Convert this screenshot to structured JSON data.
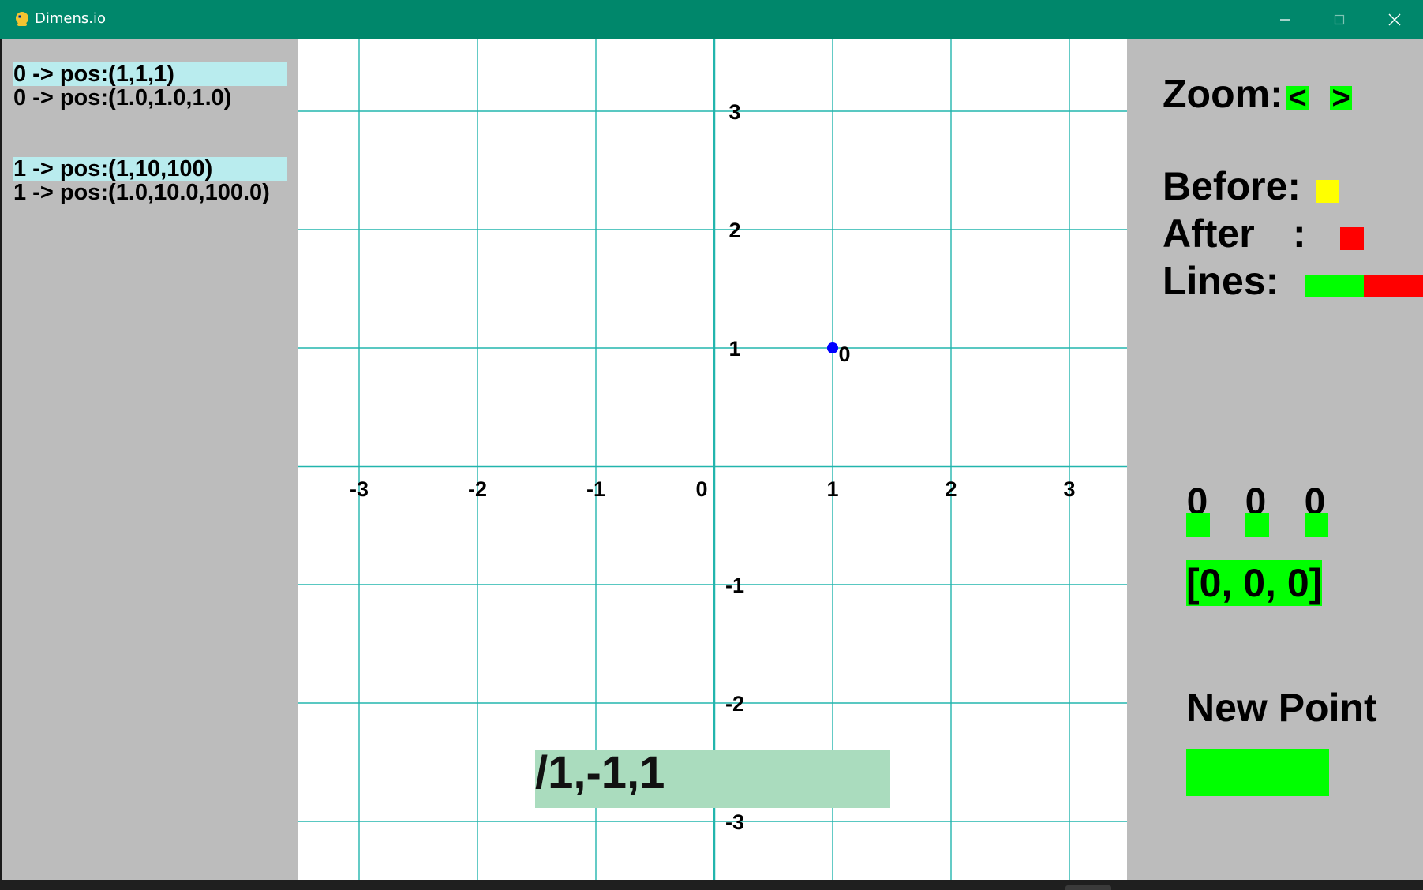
{
  "window": {
    "title": "Dimens.io",
    "app_icon": "python-snake-icon",
    "accent_color": "#00876b",
    "controls": [
      "minimize-icon",
      "maximize-icon",
      "close-icon"
    ]
  },
  "points_list": [
    {
      "raw": "0 -> pos:(1,1,1)",
      "float": "0 -> pos:(1.0,1.0,1.0)"
    },
    {
      "raw": "1 -> pos:(1,10,100)",
      "float": "1 -> pos:(1.0,10.0,100.0)"
    }
  ],
  "canvas": {
    "grid_color": "#22b5ad",
    "x_ticks": [
      "-3",
      "-2",
      "-1",
      "0",
      "1",
      "2",
      "3"
    ],
    "y_ticks": [
      "3",
      "2",
      "1",
      "-1",
      "-2",
      "-3"
    ],
    "plotted_point": {
      "label": "0",
      "x": 1,
      "y": 1,
      "color": "#0000ff"
    },
    "command_input": "/1,-1,1"
  },
  "controls": {
    "zoom_label": "Zoom:",
    "zoom_out": "<",
    "zoom_in": ">",
    "before_label": "Before:",
    "before_color": "#ffff00",
    "after_label": "After",
    "after_colon": ":",
    "after_color": "#ff0000",
    "lines_label": "Lines:",
    "lines_colors": [
      "#00ff00",
      "#ff0000"
    ],
    "coords": [
      "0",
      "0",
      "0"
    ],
    "vector": "[0, 0, 0]",
    "new_point_label": "New Point",
    "button_color": "#00ff00"
  }
}
